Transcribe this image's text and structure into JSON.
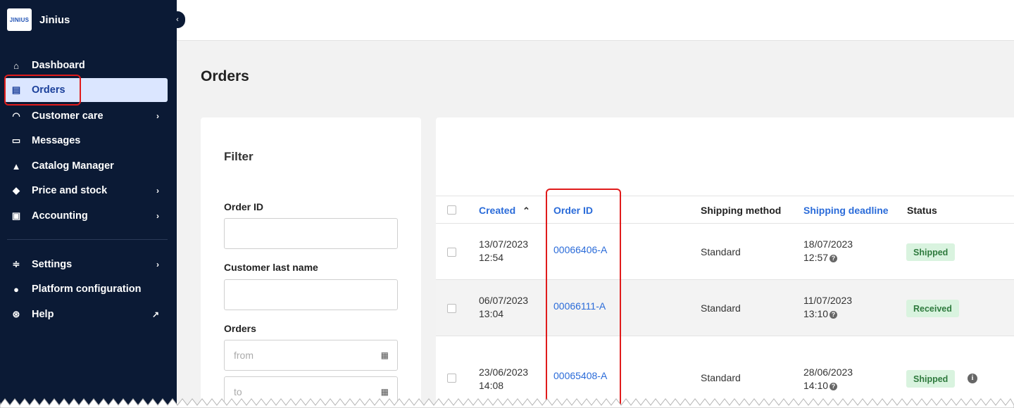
{
  "sidebar": {
    "logo_text": "JINIUS",
    "brand_name": "Jinius",
    "collapse_icon": "chevron-left-icon",
    "items": [
      {
        "label": "Dashboard",
        "icon": "home-icon",
        "glyph": "⌂",
        "has_chevron": false
      },
      {
        "label": "Orders",
        "icon": "clipboard-icon",
        "glyph": "▤",
        "active": true
      },
      {
        "label": "Customer care",
        "icon": "headset-icon",
        "glyph": "◠",
        "has_chevron": true
      },
      {
        "label": "Messages",
        "icon": "chat-icon",
        "glyph": "▭",
        "has_chevron": false
      },
      {
        "label": "Catalog Manager",
        "icon": "boxes-icon",
        "glyph": "▲",
        "has_chevron": false
      },
      {
        "label": "Price and stock",
        "icon": "tag-icon",
        "glyph": "◆",
        "has_chevron": true
      },
      {
        "label": "Accounting",
        "icon": "file-invoice-icon",
        "glyph": "▣",
        "has_chevron": true
      },
      {
        "label": "Settings",
        "icon": "sliders-icon",
        "glyph": "≑",
        "has_chevron": true
      },
      {
        "label": "Platform configuration",
        "icon": "info-circle-icon",
        "glyph": "●",
        "has_chevron": false
      },
      {
        "label": "Help",
        "icon": "life-ring-icon",
        "glyph": "⊛",
        "external_icon": "external-link-icon"
      }
    ]
  },
  "page": {
    "title": "Orders"
  },
  "filter": {
    "title": "Filter",
    "order_id_label": "Order ID",
    "customer_last_name_label": "Customer last name",
    "orders_label": "Orders",
    "from_placeholder": "from",
    "to_placeholder": "to"
  },
  "table": {
    "columns": [
      "Created",
      "Order ID",
      "Shipping method",
      "Shipping deadline",
      "Status"
    ],
    "sort_indicator": "^",
    "rows": [
      {
        "created_date": "13/07/2023",
        "created_time": "12:54",
        "order_id": "00066406-A",
        "shipping_method": "Standard",
        "deadline_date": "18/07/2023",
        "deadline_time": "12:57",
        "status": "Shipped"
      },
      {
        "created_date": "06/07/2023",
        "created_time": "13:04",
        "order_id": "00066111-A",
        "shipping_method": "Standard",
        "deadline_date": "11/07/2023",
        "deadline_time": "13:10",
        "status": "Received"
      },
      {
        "created_date": "23/06/2023",
        "created_time": "14:08",
        "order_id": "00065408-A",
        "shipping_method": "Standard",
        "deadline_date": "28/06/2023",
        "deadline_time": "14:10",
        "status": "Shipped",
        "has_info": true
      }
    ]
  },
  "colors": {
    "sidebar_bg": "#0b1a35",
    "active_bg": "#dbe6ff",
    "link": "#2a6bd9",
    "badge_bg": "#d9f3df",
    "badge_text": "#2e7a3d",
    "highlight": "#e01b1b"
  }
}
